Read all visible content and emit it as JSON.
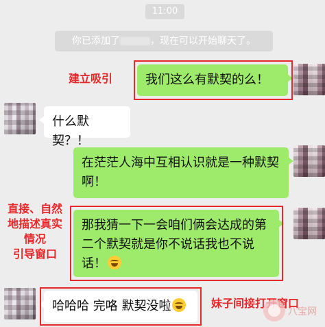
{
  "timestamp": "11:00",
  "system_message": {
    "prefix": "你已添加了",
    "suffix": "，现在可以开始聊天了。"
  },
  "messages": [
    {
      "side": "right",
      "text": "我们这么有默契的么！"
    },
    {
      "side": "left",
      "text": "什么默契？！"
    },
    {
      "side": "right",
      "text": "在茫茫人海中互相认识就是一种默契啊！"
    },
    {
      "side": "right",
      "text": "那我猜一下一会咱们俩会达成的第二个默契就是你不说话我也不说话！",
      "emoji": "laugh-cry-emoji"
    },
    {
      "side": "left",
      "text": "哈哈哈 完咯 默契没啦",
      "emoji": "thinking-emoji"
    }
  ],
  "annotations": {
    "attract": "建立吸引",
    "describe": [
      "直接、自然",
      "地描述真实",
      "情况",
      "引导窗口"
    ],
    "girl": "妹子间接打开窗口"
  },
  "watermark": "八宝网",
  "colors": {
    "background": "#ededed",
    "bubble_green": "#9eea6a",
    "bubble_white": "#ffffff",
    "annotation_red": "#e6282b"
  }
}
